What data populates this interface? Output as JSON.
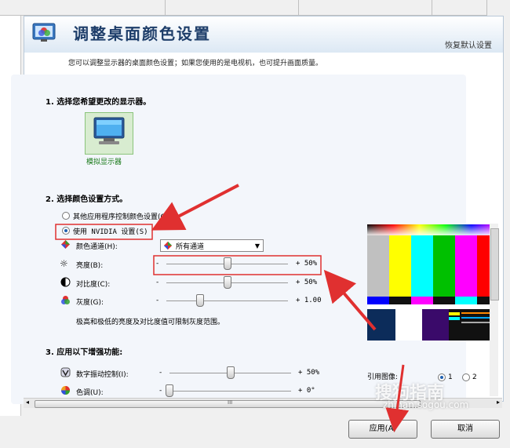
{
  "header": {
    "title": "调整桌面颜色设置",
    "restore_defaults": "恢复默认设置",
    "description": "您可以调整显示器的桌面颜色设置；如果您使用的是电视机，也可提升画面质量。"
  },
  "section1": {
    "heading": "1. 选择您希望更改的显示器。",
    "monitor_label": "模拟显示器"
  },
  "section2": {
    "heading": "2. 选择颜色设置方式。",
    "radio_other": "其他应用程序控制颜色设置(O)",
    "radio_nvidia": "使用 NVIDIA 设置(S)",
    "channel_label": "颜色通道(H):",
    "channel_value": "所有通道",
    "brightness_label": "亮度(B):",
    "brightness_value": "+ 50%",
    "brightness_level": 0.5,
    "contrast_label": "对比度(C):",
    "contrast_value": "+ 50%",
    "contrast_level": 0.5,
    "gamma_label": "灰度(G):",
    "gamma_value": "+ 1.00",
    "gamma_level": 0.28,
    "minus": "-",
    "note": "极高和极低的亮度及对比度值可限制灰度范围。"
  },
  "section3": {
    "heading": "3. 应用以下增强功能:",
    "vibrance_label": "数字振动控制(I):",
    "vibrance_value": "+ 50%",
    "vibrance_level": 0.5,
    "hue_label": "色调(U):",
    "hue_value": "+ 0°",
    "hue_level": 0.0,
    "minus": "-"
  },
  "reference": {
    "label": "引用图像:",
    "options": [
      "1",
      "2"
    ],
    "selected": "1"
  },
  "scroll": {
    "marker": "III"
  },
  "buttons": {
    "apply": "应用(A)",
    "cancel": "取消"
  },
  "watermark": {
    "brand": "搜狗指南",
    "url": "zhinan.sogou.com"
  },
  "colors": {
    "annotation": "#e03030",
    "title": "#1e3e6a"
  }
}
